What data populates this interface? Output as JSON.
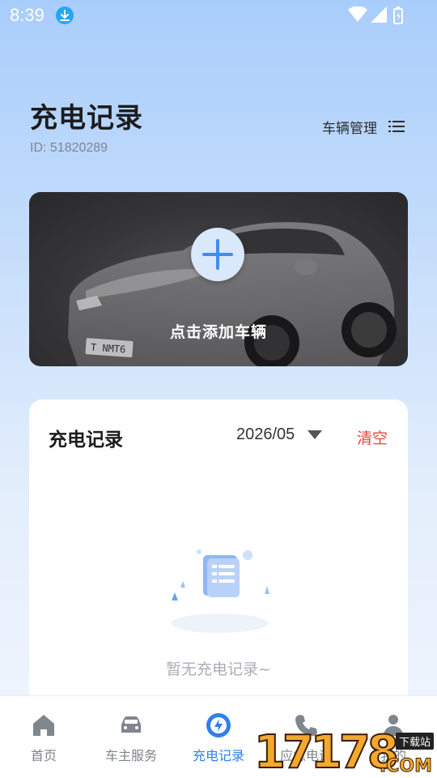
{
  "status_bar": {
    "time": "8:39"
  },
  "header": {
    "title": "充电记录",
    "user_id": "ID: 51820289",
    "vehicle_mgmt_label": "车辆管理"
  },
  "add_vehicle": {
    "label": "点击添加车辆",
    "plate_text": "T NMT6"
  },
  "records": {
    "title": "充电记录",
    "month": "2026/05",
    "clear_label": "清空",
    "empty_text": "暂无充电记录~"
  },
  "bottom_nav": {
    "items": [
      {
        "label": "首页",
        "icon": "home-icon"
      },
      {
        "label": "车主服务",
        "icon": "car-icon"
      },
      {
        "label": "充电记录",
        "icon": "lightning-icon",
        "active": true
      },
      {
        "label": "应急电话",
        "icon": "phone-icon"
      },
      {
        "label": "我的",
        "icon": "person-icon"
      }
    ]
  },
  "watermark": {
    "logo": "17178",
    "tag": "下载站",
    "suffix": ".COM"
  },
  "colors": {
    "accent": "#2f7fee",
    "danger": "#e4483f",
    "card_dark": "#3f3f42"
  }
}
